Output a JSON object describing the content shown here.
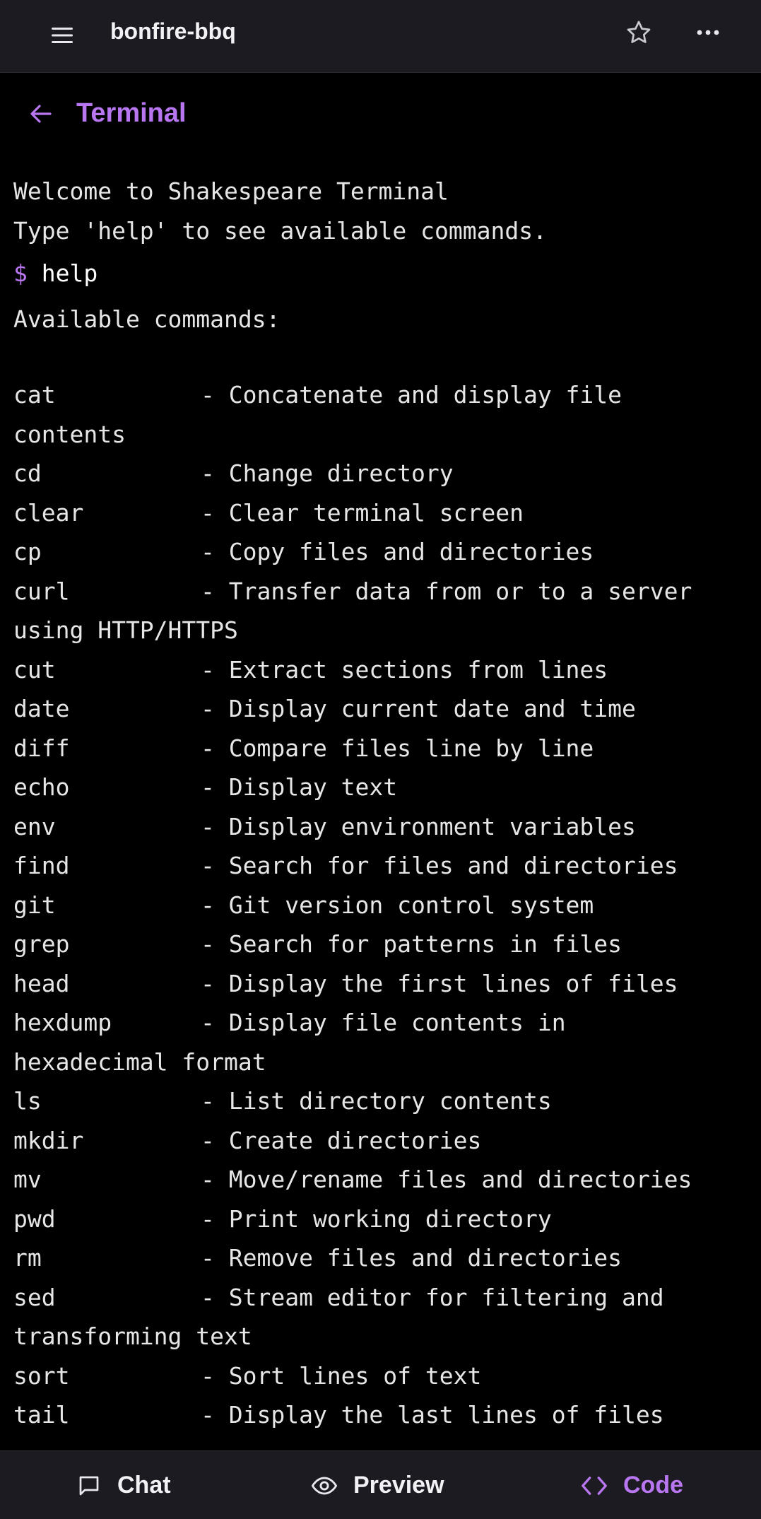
{
  "header": {
    "project_name": "bonfire-bbq",
    "icons": [
      "menu-icon",
      "star-icon",
      "more-icon"
    ]
  },
  "terminal_panel": {
    "title": "Terminal",
    "back_icon": "arrow-left-icon"
  },
  "terminal": {
    "welcome": "Welcome to Shakespeare Terminal",
    "hint": "Type 'help' to see available commands.",
    "prompt_symbol": "$",
    "command": "help",
    "available_header": "Available commands:",
    "commands": [
      {
        "name": "cat",
        "desc": "- Concatenate and display file",
        "cont": "contents"
      },
      {
        "name": "cd",
        "desc": "- Change directory"
      },
      {
        "name": "clear",
        "desc": "- Clear terminal screen"
      },
      {
        "name": "cp",
        "desc": "- Copy files and directories"
      },
      {
        "name": "curl",
        "desc": "- Transfer data from or to a server",
        "cont": "using HTTP/HTTPS"
      },
      {
        "name": "cut",
        "desc": "- Extract sections from lines"
      },
      {
        "name": "date",
        "desc": "- Display current date and time"
      },
      {
        "name": "diff",
        "desc": "- Compare files line by line"
      },
      {
        "name": "echo",
        "desc": "- Display text"
      },
      {
        "name": "env",
        "desc": "- Display environment variables"
      },
      {
        "name": "find",
        "desc": "- Search for files and directories"
      },
      {
        "name": "git",
        "desc": "- Git version control system"
      },
      {
        "name": "grep",
        "desc": "- Search for patterns in files"
      },
      {
        "name": "head",
        "desc": "- Display the first lines of files"
      },
      {
        "name": "hexdump",
        "desc": "- Display file contents in",
        "cont": "hexadecimal format"
      },
      {
        "name": "ls",
        "desc": "- List directory contents"
      },
      {
        "name": "mkdir",
        "desc": "- Create directories"
      },
      {
        "name": "mv",
        "desc": "- Move/rename files and directories"
      },
      {
        "name": "pwd",
        "desc": "- Print working directory"
      },
      {
        "name": "rm",
        "desc": "- Remove files and directories"
      },
      {
        "name": "sed",
        "desc": "- Stream editor for filtering and",
        "cont": "transforming text"
      },
      {
        "name": "sort",
        "desc": "- Sort lines of text"
      },
      {
        "name": "tail",
        "desc": "- Display the last lines of files"
      }
    ]
  },
  "bottom_nav": {
    "chat": "Chat",
    "preview": "Preview",
    "code": "Code",
    "active": "code"
  },
  "colors": {
    "accent": "#b877f0",
    "bar_background": "#1c1b22",
    "terminal_background": "#000000",
    "terminal_text": "#e6e6e6"
  }
}
